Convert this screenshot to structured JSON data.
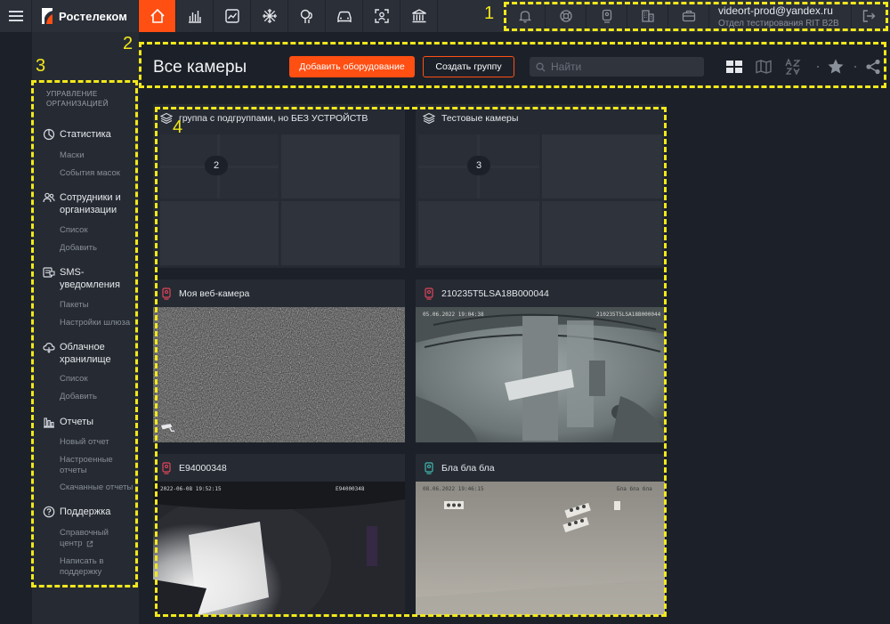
{
  "brand": {
    "name": "Ростелеком"
  },
  "topbar": {
    "nav_icons": [
      "home-icon",
      "bar-chart-icon",
      "line-chart-icon",
      "snowflake-icon",
      "face-icon",
      "car-icon",
      "face-scan-icon",
      "bank-icon"
    ],
    "active_nav": "home-icon",
    "right_icons": [
      "bell-icon",
      "lifebuoy-icon",
      "camera-device-icon",
      "building-icon",
      "briefcase-icon"
    ],
    "user": {
      "email": "videort-prod@yandex.ru",
      "department": "Отдел тестирования RIT B2B"
    }
  },
  "sidebar": {
    "title_line1": "УПРАВЛЕНИЕ",
    "title_line2": "ОРГАНИЗАЦИЕЙ",
    "sections": [
      {
        "icon": "statistics-icon",
        "label_line1": "Статистика",
        "label_line2": "",
        "links": [
          "Маски",
          "События масок"
        ]
      },
      {
        "icon": "people-icon",
        "label_line1": "Сотрудники и",
        "label_line2": "организации",
        "links": [
          "Список",
          "Добавить"
        ]
      },
      {
        "icon": "sms-icon",
        "label_line1": "SMS-",
        "label_line2": "уведомления",
        "links": [
          "Пакеты",
          "Настройки шлюза"
        ]
      },
      {
        "icon": "cloud-icon",
        "label_line1": "Облачное",
        "label_line2": "хранилище",
        "links": [
          "Список",
          "Добавить"
        ]
      },
      {
        "icon": "reports-icon",
        "label_line1": "Отчеты",
        "label_line2": "",
        "links": [
          "Новый отчет",
          "Настроенные",
          "отчеты",
          "Скачанные отчеты"
        ]
      },
      {
        "icon": "help-icon",
        "label_line1": "Поддержка",
        "label_line2": "",
        "links": [
          "Справочный",
          "центр",
          "Написать в",
          "поддержку"
        ]
      }
    ]
  },
  "header": {
    "title": "Все камеры",
    "add_button": "Добавить оборудование",
    "group_button": "Создать группу",
    "search_placeholder": "Найти"
  },
  "tiles": [
    {
      "type": "group",
      "name": "группа с подгруппами, но БЕЗ УСТРОЙСТВ",
      "count": "2"
    },
    {
      "type": "group",
      "name": "Тестовые камеры",
      "count": "3"
    },
    {
      "type": "camera",
      "name": "Моя веб-камера",
      "status": "offline"
    },
    {
      "type": "camera",
      "name": "210235T5LSA18B000044",
      "status": "offline",
      "osd_left": "05.06.2022 19:04:38",
      "osd_right": "210235T5LSA18B000044"
    },
    {
      "type": "camera",
      "name": "E94000348",
      "status": "offline",
      "osd_left": "2022-06-08 19:52:15",
      "osd_right": "E94000348"
    },
    {
      "type": "camera",
      "name": "Бла бла бла",
      "status": "online",
      "osd_left": "08.06.2022 19:46:15",
      "osd_right": "Бла бла бла"
    }
  ],
  "annotations": [
    "1",
    "2",
    "3",
    "4"
  ],
  "colors": {
    "accent": "#ff4f12",
    "annotation": "#f2e81b",
    "online": "#3fb8af",
    "offline": "#e0455a"
  }
}
